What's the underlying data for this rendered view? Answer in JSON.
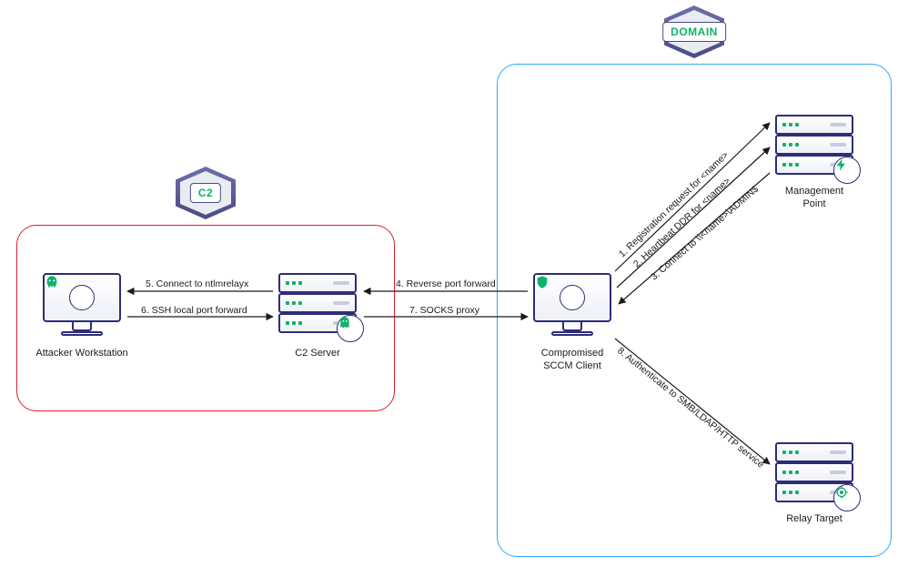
{
  "zones": {
    "c2": {
      "label": "C2"
    },
    "domain": {
      "label": "DOMAIN"
    }
  },
  "nodes": {
    "attacker": {
      "label": "Attacker Workstation",
      "glyph": "skull"
    },
    "c2server": {
      "label": "C2 Server",
      "glyph": "ghost"
    },
    "sccm": {
      "label": "Compromised\nSCCM Client",
      "glyph": "shield"
    },
    "mgmtpoint": {
      "label": "Management\nPoint",
      "glyph": "bolt"
    },
    "relaytarget": {
      "label": "Relay Target",
      "glyph": "target"
    }
  },
  "arrows": {
    "a1": "1. Registration request for <name>",
    "a2": "2. Heartbeat DDR for <name>",
    "a3": "3. Connect to \\\\<name>\\ADMIN$",
    "a4": "4. Reverse port forward",
    "a5": "5. Connect to ntlmrelayx",
    "a6": "6. SSH local port forward",
    "a7": "7. SOCKS proxy",
    "a8": "8. Authenticate to SMB/LDAP/HTTP service"
  },
  "colors": {
    "c2_border": "#e11d2e",
    "domain_border": "#2aa9ff",
    "accent_green": "#0eb36a",
    "stroke": "#1b1b1b"
  }
}
